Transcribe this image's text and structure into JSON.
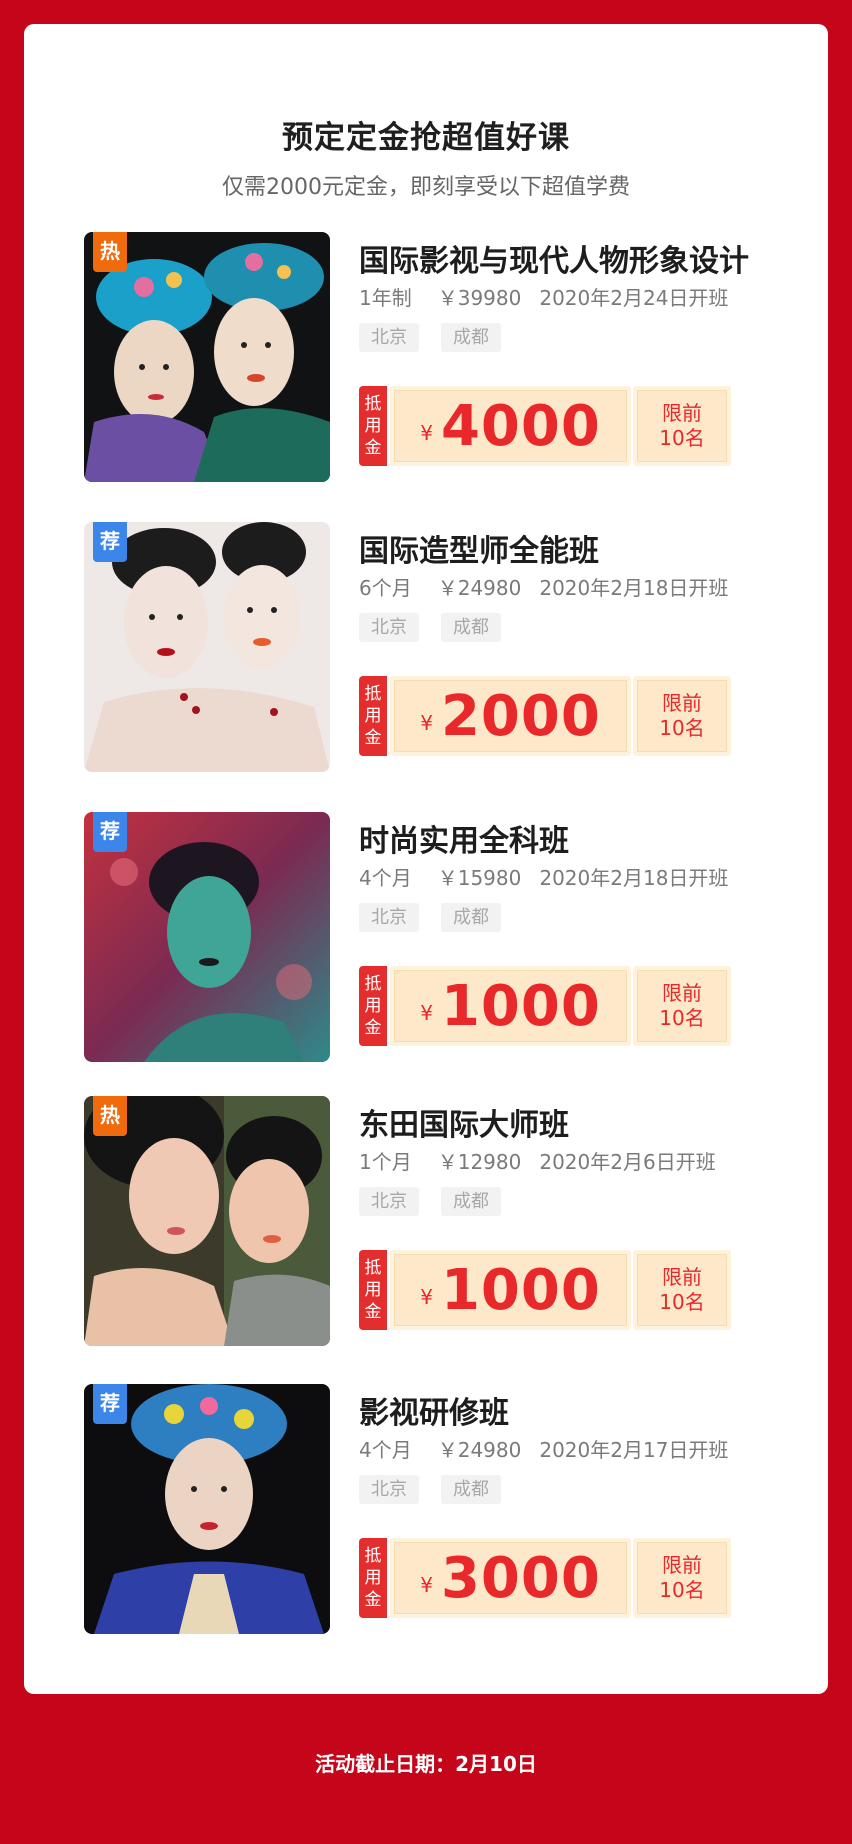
{
  "header": {
    "title": "预定定金抢超值好课",
    "subtitle": "仅需2000元定金，即刻享受以下超值学费"
  },
  "coupon_common": {
    "left_chars": [
      "抵",
      "用",
      "金"
    ],
    "yen": "¥",
    "limit_line1": "限前",
    "limit_line2": "10名"
  },
  "courses": [
    {
      "tag": "热",
      "tag_type": "hot",
      "title": "国际影视与现代人物形象设计",
      "duration": "1年制",
      "price": "￥39980",
      "start": "2020年2月24日开班",
      "cities": [
        "北京",
        "成都"
      ],
      "voucher": "4000",
      "image_desc": "two-women-qing-headdress-photo"
    },
    {
      "tag": "荐",
      "tag_type": "rec",
      "title": "国际造型师全能班",
      "duration": "6个月",
      "price": "￥24980",
      "start": "2020年2月18日开班",
      "cities": [
        "北京",
        "成都"
      ],
      "voucher": "2000",
      "image_desc": "two-women-short-hair-photo"
    },
    {
      "tag": "荐",
      "tag_type": "rec",
      "title": "时尚实用全科班",
      "duration": "4个月",
      "price": "￥15980",
      "start": "2020年2月18日开班",
      "cities": [
        "北京",
        "成都"
      ],
      "voucher": "1000",
      "image_desc": "woman-colorful-light-photo"
    },
    {
      "tag": "热",
      "tag_type": "hot",
      "title": "东田国际大师班",
      "duration": "1个月",
      "price": "￥12980",
      "start": "2020年2月6日开班",
      "cities": [
        "北京",
        "成都"
      ],
      "voucher": "1000",
      "image_desc": "two-women-beauty-photo"
    },
    {
      "tag": "荐",
      "tag_type": "rec",
      "title": "影视研修班",
      "duration": "4个月",
      "price": "￥24980",
      "start": "2020年2月17日开班",
      "cities": [
        "北京",
        "成都"
      ],
      "voucher": "3000",
      "image_desc": "woman-blue-headdress-photo"
    }
  ],
  "footer": {
    "deadline": "活动截止日期：2月10日"
  },
  "colors": {
    "page_bg": "#c4051a",
    "coupon_red": "#e8282b",
    "coupon_bg": "#fde9c9",
    "tag_hot": "#f06a0e",
    "tag_rec": "#3b86e8"
  }
}
